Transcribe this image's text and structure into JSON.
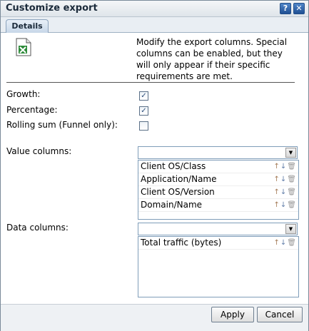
{
  "dialog": {
    "title": "Customize export",
    "help_icon": "?",
    "close_icon": "✕",
    "tab_label": "Details"
  },
  "description": "Modify the export columns. Special columns can be enabled, but they will only appear if their specific requirements are met.",
  "options": [
    {
      "label": "Growth:",
      "checked": true
    },
    {
      "label": "Percentage:",
      "checked": true
    },
    {
      "label": "Rolling sum (Funnel only):",
      "checked": false
    }
  ],
  "value_columns": {
    "label": "Value columns:",
    "selected": "",
    "items": [
      "Client OS/Class",
      "Application/Name",
      "Client OS/Version",
      "Domain/Name"
    ]
  },
  "data_columns": {
    "label": "Data columns:",
    "selected": "",
    "items": [
      "Total traffic (bytes)"
    ]
  },
  "footer": {
    "apply_label": "Apply",
    "cancel_label": "Cancel"
  },
  "icons": {
    "export": "excel-file-icon",
    "move_up": "arrow-up-icon",
    "move_down": "arrow-down-icon",
    "delete": "trash-icon"
  }
}
